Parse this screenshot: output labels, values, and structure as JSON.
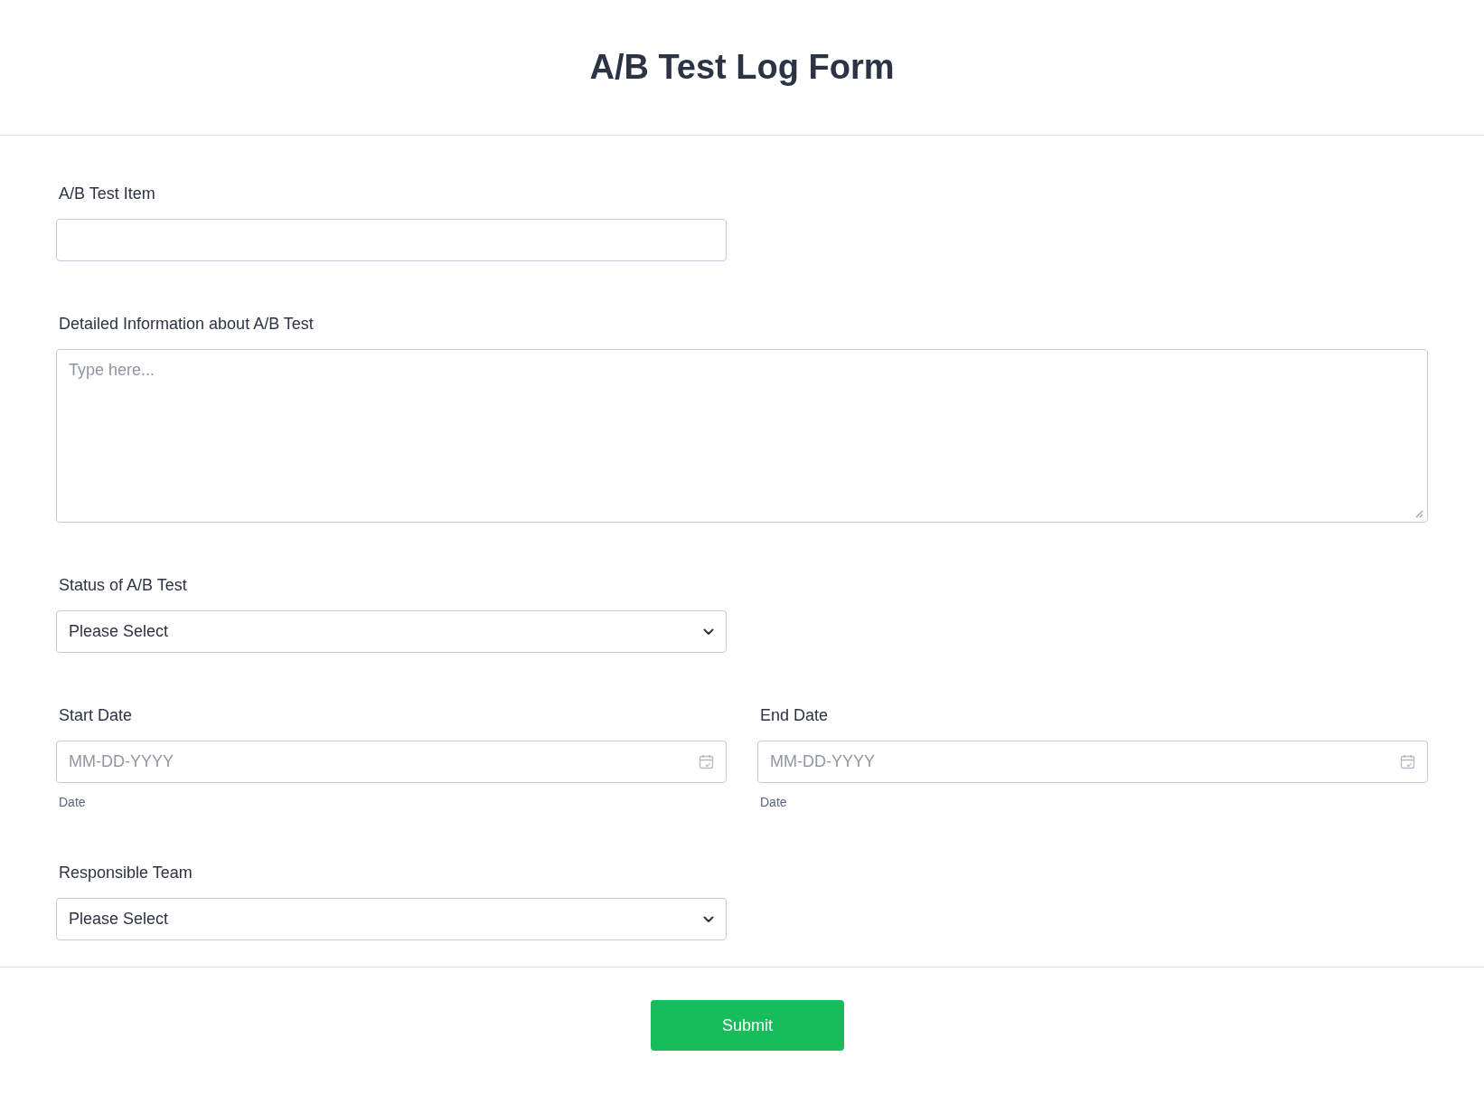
{
  "header": {
    "title": "A/B Test Log Form"
  },
  "fields": [
    {
      "kind": "text",
      "label": "A/B Test Item"
    },
    {
      "kind": "textarea",
      "label": "Detailed Information about A/B Test",
      "placeholder": "Type here..."
    },
    {
      "kind": "select",
      "label": "Status of A/B Test",
      "value": "Please Select"
    },
    {
      "kind": "dates",
      "items": [
        {
          "label": "Start Date",
          "placeholder": "MM-DD-YYYY",
          "sublabel": "Date"
        },
        {
          "label": "End Date",
          "placeholder": "MM-DD-YYYY",
          "sublabel": "Date"
        }
      ]
    },
    {
      "kind": "select",
      "label": "Responsible Team",
      "value": "Please Select"
    }
  ],
  "footer": {
    "button": "Submit"
  }
}
